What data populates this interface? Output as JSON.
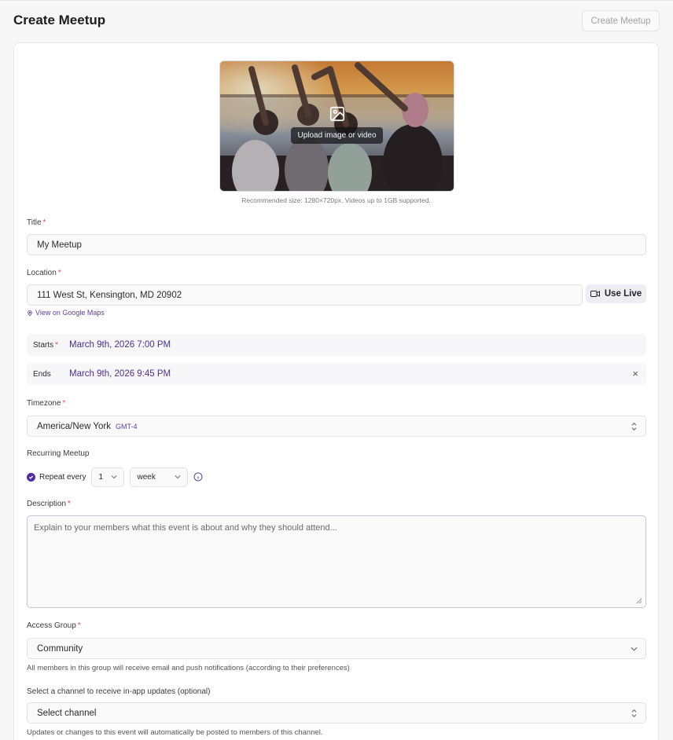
{
  "header": {
    "title": "Create Meetup",
    "create_button": "Create Meetup"
  },
  "upload": {
    "label": "Upload image or video",
    "recommendation": "Recommended size: 1280×720px. Videos up to 1GB supported."
  },
  "form": {
    "title_label": "Title",
    "title_value": "My Meetup",
    "location_label": "Location",
    "location_value": "111 West St, Kensington, MD 20902",
    "use_live_label": "Use Live",
    "maps_link": "View on Google Maps",
    "starts_label": "Starts",
    "starts_value": "March 9th, 2026 7:00 PM",
    "ends_label": "Ends",
    "ends_value": "March 9th, 2026 9:45 PM",
    "close_symbol": "×",
    "timezone_label": "Timezone",
    "timezone_value": "America/New York",
    "timezone_offset": "GMT-4",
    "recurring_label": "Recurring Meetup",
    "repeat_label": "Repeat every",
    "repeat_count": "1",
    "repeat_unit": "week",
    "description_label": "Description",
    "description_placeholder": "Explain to your members what this event is about and why they should attend...",
    "access_group_label": "Access Group",
    "access_group_value": "Community",
    "access_group_help": "All members in this group will receive email and push notifications (according to their preferences)",
    "channel_label": "Select a channel to receive in-app updates (optional)",
    "channel_value": "Select channel",
    "channel_help": "Updates or changes to this event will automatically be posted to members of this channel.",
    "required_mark": "*"
  },
  "colors": {
    "accent": "#4f2ca1",
    "link": "#5b3fa8",
    "required": "#e5484d"
  },
  "icons": {
    "upload": "image-icon",
    "live": "video-camera-icon",
    "maps": "map-pin-icon",
    "info": "info-icon",
    "check": "check-icon"
  }
}
